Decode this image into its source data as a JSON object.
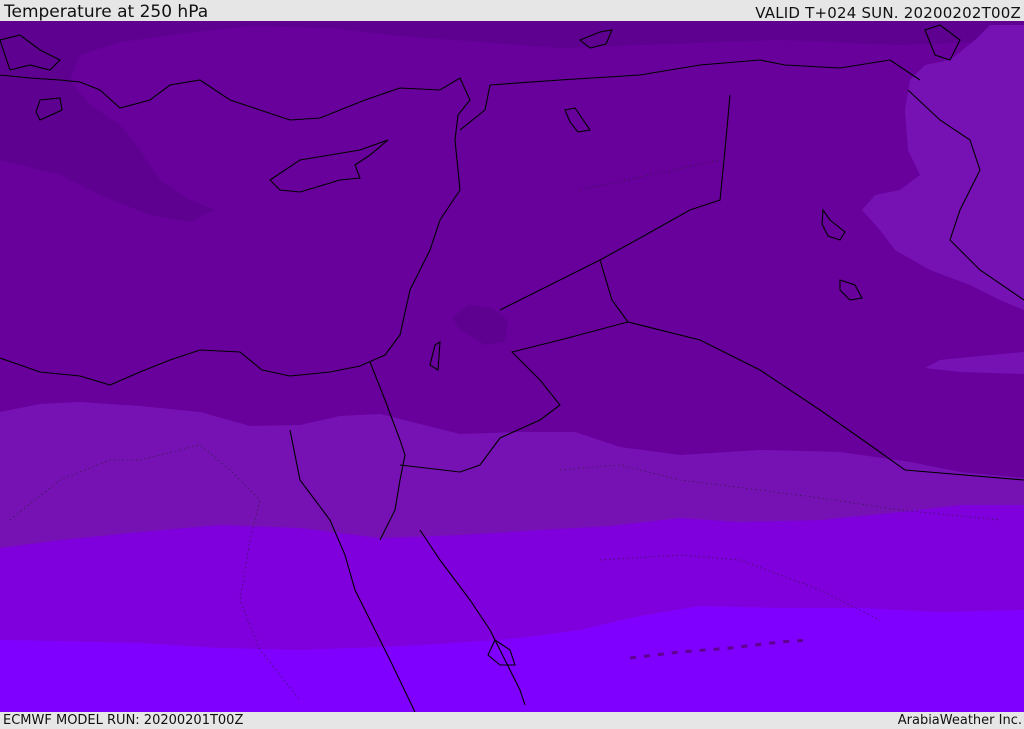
{
  "header": {
    "title": "Temperature at 250 hPa",
    "valid": "VALID T+024 SUN. 20200202T00Z"
  },
  "footer": {
    "model_run": "ECMWF MODEL RUN: 20200201T00Z",
    "credit": "ArabiaWeather Inc."
  },
  "map": {
    "parameter": "Temperature",
    "level": "250 hPa",
    "colors": {
      "band_coldest": "#5e0090",
      "band_1": "#68009c",
      "band_2": "#7612b4",
      "band_3": "#7f00dc",
      "band_warmest": "#8000ff",
      "coastline": "#000000"
    }
  }
}
